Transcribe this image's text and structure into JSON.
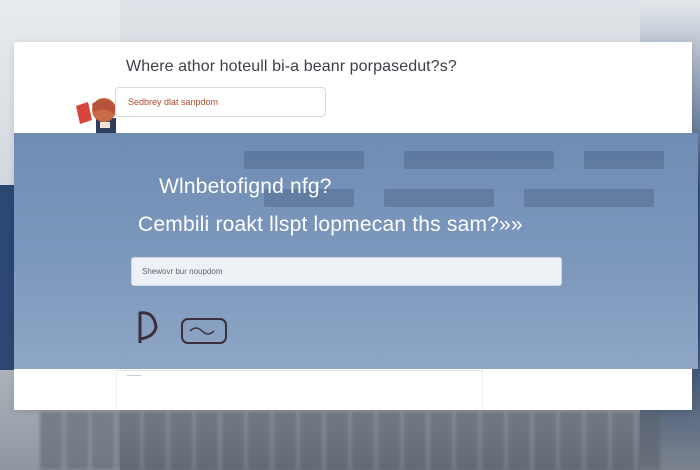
{
  "header": {
    "question": "Where athor hoteull bi-a beanr porpasedut?s?",
    "input_placeholder": "Sedbrey dlat sanpdom"
  },
  "panel": {
    "question_1": "Wlnbetofignd nfg?",
    "question_2": "Cembili roakt llspt lopmecan ths sam?»»",
    "input_placeholder": "Shewovr bur noupdom"
  },
  "colors": {
    "panel_blue": "#7d98bd",
    "accent_red": "#b24a2c",
    "card_white": "#ffffff"
  },
  "icons": {
    "avatar": "person-avatar-icon"
  }
}
